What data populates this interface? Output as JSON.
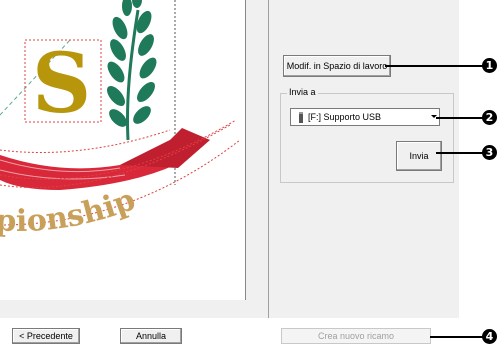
{
  "toolbar": {
    "edit_in_workspace_label": "Modif. in Spazio di lavoro"
  },
  "send_group": {
    "title": "Invia a",
    "selected_destination": "[F:] Supporto USB",
    "send_label": "Invia",
    "device_icon": "usb-drive-icon",
    "dropdown_icon": "chevron-down-icon"
  },
  "footer": {
    "back_label": "< Precedente",
    "cancel_label": "Annulla",
    "create_new_label": "Crea nuovo ricamo"
  },
  "callouts": [
    "1",
    "2",
    "3",
    "4"
  ],
  "canvas": {
    "monogram_letter": "S",
    "ribbon_text": "pionship"
  },
  "colors": {
    "window_bg": "#f0f0f0",
    "letter_gold": "#b8960c",
    "ribbon_red": "#d8283a",
    "leaf_green": "#1f7a5a",
    "ribbon_text": "#c9a05a",
    "callout_black": "#000000"
  }
}
